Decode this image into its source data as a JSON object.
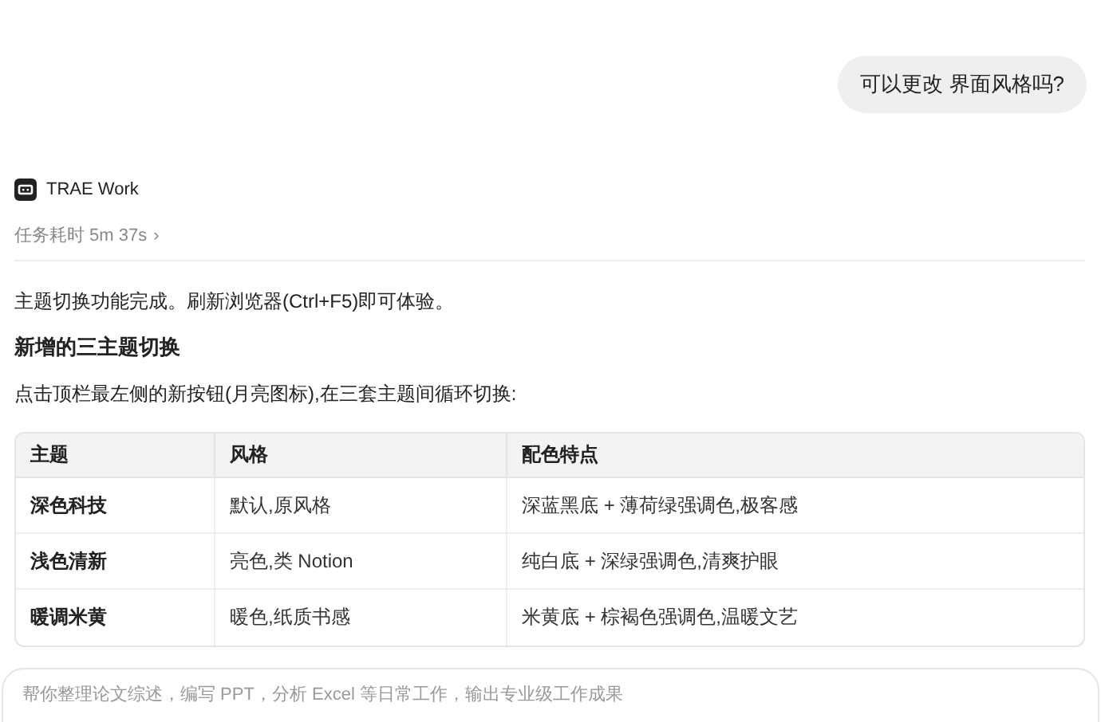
{
  "user_message": "可以更改 界面风格吗?",
  "agent": {
    "name": "TRAE Work",
    "duration": "任务耗时 5m 37s",
    "duration_chevron": "›"
  },
  "reply": {
    "intro": "主题切换功能完成。刷新浏览器(Ctrl+F5)即可体验。",
    "heading": "新增的三主题切换",
    "description": "点击顶栏最左侧的新按钮(月亮图标),在三套主题间循环切换:"
  },
  "table": {
    "columns": [
      "主题",
      "风格",
      "配色特点"
    ],
    "rows": [
      [
        "深色科技",
        "默认,原风格",
        "深蓝黑底 + 薄荷绿强调色,极客感"
      ],
      [
        "浅色清新",
        "亮色,类 Notion",
        "纯白底 + 深绿强调色,清爽护眼"
      ],
      [
        "暖调米黄",
        "暖色,纸质书感",
        "米黄底 + 棕褐色强调色,温暖文艺"
      ]
    ]
  },
  "composer": {
    "placeholder": "帮你整理论文综述，编写 PPT，分析 Excel 等日常工作，输出专业级工作成果"
  }
}
